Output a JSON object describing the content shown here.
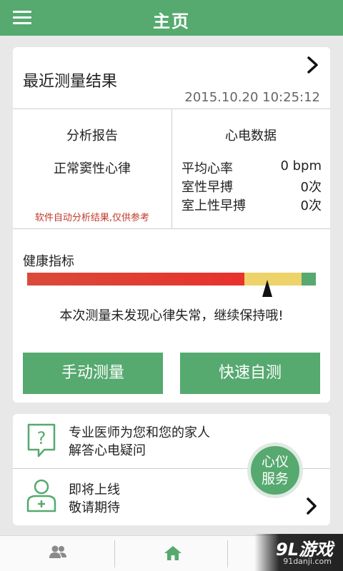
{
  "header": {
    "title": "主页",
    "menu_icon": "menu-icon"
  },
  "recent": {
    "title": "最近测量结果",
    "timestamp": "2015.10.20 10:25:12",
    "analysis": {
      "title": "分析报告",
      "result": "正常窦性心律",
      "note": "软件自动分析结果,仅供参考"
    },
    "ecg": {
      "title": "心电数据",
      "rows": [
        {
          "label": "平均心率",
          "value": "0 bpm"
        },
        {
          "label": "室性早搏",
          "value": "0次"
        },
        {
          "label": "室上性早搏",
          "value": "0次"
        }
      ]
    }
  },
  "health": {
    "label": "健康指标",
    "message": "本次测量未发现心律失常，继续保持哦!",
    "colors": {
      "red": "#e8322b",
      "yellow": "#edd369",
      "green": "#56a96f"
    }
  },
  "buttons": {
    "manual": "手动测量",
    "quick": "快速自测"
  },
  "services": {
    "doctor": {
      "line1": "专业医师为您和您的家人",
      "line2": "解答心电疑问",
      "icon": "question-bubble-icon"
    },
    "coming": {
      "line1": "即将上线",
      "line2": "敬请期待",
      "icon": "add-user-icon"
    }
  },
  "badge": {
    "line1": "心仪",
    "line2": "服务"
  },
  "bottom_nav": {
    "icons": [
      "people-icon",
      "home-icon"
    ]
  },
  "watermark": {
    "main": "9L游戏",
    "sub": "91danji.com"
  },
  "colors": {
    "accent": "#56a96f",
    "note_red": "#c0392b"
  }
}
